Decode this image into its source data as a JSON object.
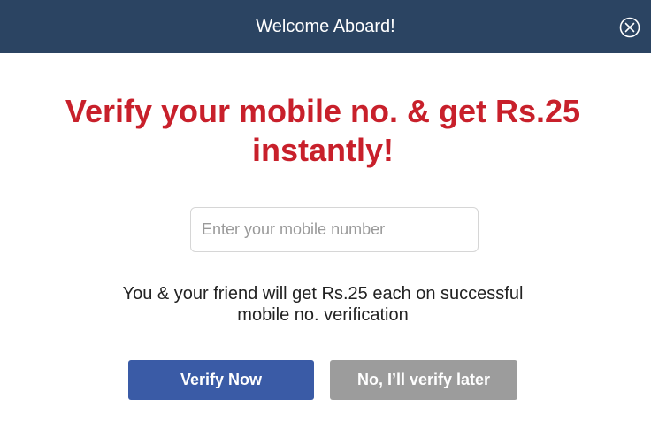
{
  "header": {
    "title": "Welcome Aboard!",
    "background_color": "#2b4462",
    "close_icon": "close-circle-icon"
  },
  "main": {
    "headline": "Verify your mobile no. & get Rs.25 instantly!",
    "headline_color": "#c8202b",
    "mobile_input": {
      "placeholder": "Enter your mobile number",
      "value": ""
    },
    "info_text": "You & your friend will get Rs.25 each on successful mobile no. verification"
  },
  "actions": {
    "verify_label": "Verify Now",
    "verify_color": "#3a5ba6",
    "later_label": "No, I’ll verify later",
    "later_color": "#9c9c9c"
  }
}
